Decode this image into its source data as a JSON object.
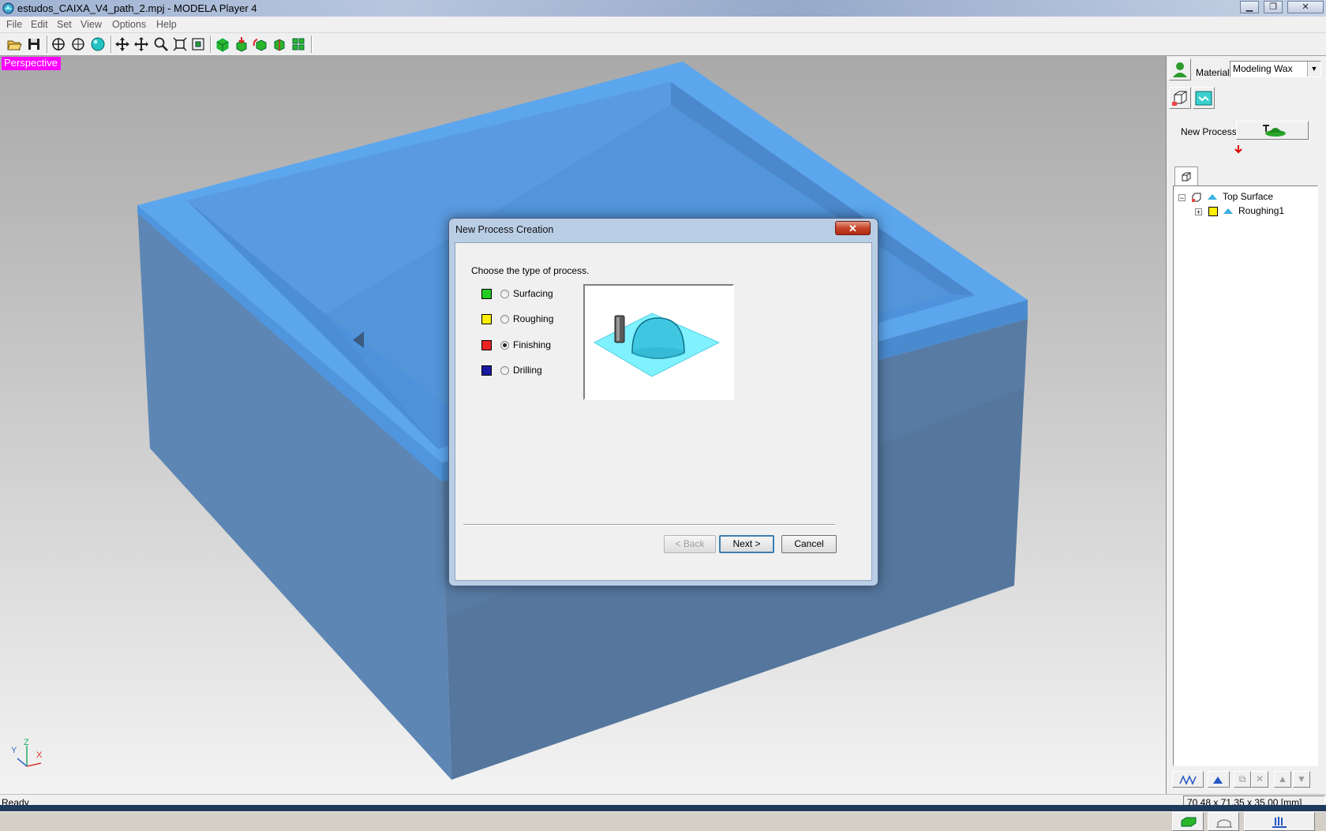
{
  "window": {
    "title": "estudos_CAIXA_V4_path_2.mpj - MODELA Player 4",
    "controls": [
      "minimize",
      "restore",
      "close"
    ]
  },
  "menu": [
    "File",
    "Edit",
    "Set",
    "View",
    "Options",
    "Help"
  ],
  "toolbar": {
    "buttons": [
      "open-icon",
      "save-icon",
      "view-fit-icon",
      "view-target-icon",
      "render-sphere-icon",
      "pan-icon",
      "move-icon",
      "zoom-icon",
      "zoom-fit-icon",
      "zoom-extents-icon",
      "model-green-icon",
      "import-model-icon",
      "rotate-model-icon",
      "model-position-icon",
      "layout-icon"
    ]
  },
  "viewport": {
    "label": "Perspective",
    "axes": {
      "x": "X",
      "y": "Y",
      "z": "Z"
    },
    "model_color": "#5b9be6"
  },
  "panel": {
    "material_label": "Material",
    "material_value": "Modeling Wax",
    "new_process_label": "New Process",
    "tree": [
      {
        "label": "Top Surface",
        "expander": "−"
      },
      {
        "label": "Roughing1",
        "expander": "+"
      }
    ]
  },
  "dialog": {
    "title": "New Process Creation",
    "close_label": "✕",
    "prompt": "Choose the type of process.",
    "options": [
      {
        "label": "Surfacing",
        "selected": false,
        "icon_color": "#22cc22"
      },
      {
        "label": "Roughing",
        "selected": false,
        "icon_color": "#ffee00"
      },
      {
        "label": "Finishing",
        "selected": true,
        "icon_color": "#ee2222"
      },
      {
        "label": "Drilling",
        "selected": false,
        "icon_color": "#1a1aa0"
      }
    ],
    "back_label": "< Back",
    "next_label": "Next >",
    "cancel_label": "Cancel"
  },
  "status": {
    "left": "Ready",
    "dimensions": "70.48 x 71.35 x 35.00 [mm]"
  }
}
